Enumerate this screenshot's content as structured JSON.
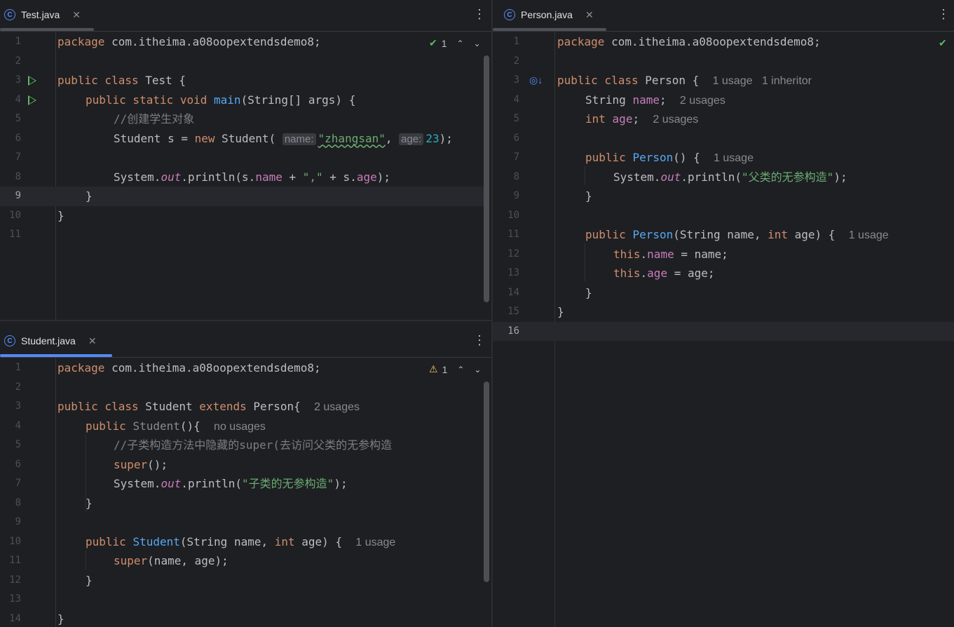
{
  "tabs": {
    "test": {
      "label": "Test.java",
      "close": "✕",
      "icon": "C"
    },
    "student": {
      "label": "Student.java",
      "close": "✕",
      "icon": "C"
    },
    "person": {
      "label": "Person.java",
      "close": "✕",
      "icon": "C"
    }
  },
  "status": {
    "test": {
      "icon": "✔",
      "count": "1",
      "up": "⌃",
      "down": "⌄"
    },
    "student": {
      "icon": "⚠",
      "count": "1",
      "up": "⌃",
      "down": "⌄"
    },
    "person": {
      "icon": "✔"
    }
  },
  "colors": {
    "accent": "#548af7",
    "ok": "#5fb865",
    "warn": "#f2c55c"
  },
  "test_lines": [
    "1",
    "2",
    "3",
    "4",
    "5",
    "6",
    "7",
    "8",
    "9",
    "10",
    "11"
  ],
  "student_lines": [
    "1",
    "2",
    "3",
    "4",
    "5",
    "6",
    "7",
    "8",
    "9",
    "10",
    "11",
    "12",
    "13",
    "14"
  ],
  "person_lines": [
    "1",
    "2",
    "3",
    "4",
    "5",
    "6",
    "7",
    "8",
    "9",
    "10",
    "11",
    "12",
    "13",
    "14",
    "15",
    "16"
  ]
}
